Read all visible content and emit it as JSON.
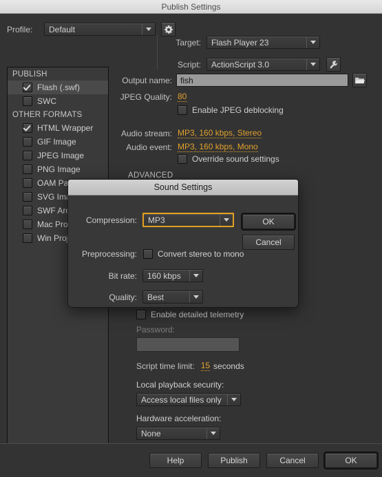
{
  "window": {
    "title": "Publish Settings"
  },
  "toolbar": {
    "profile_label": "Profile:",
    "profile_value": "Default",
    "profile_gear_icon": "gear-icon",
    "target_label": "Target:",
    "target_value": "Flash Player 23",
    "script_label": "Script:",
    "script_value": "ActionScript 3.0",
    "script_wrench_icon": "wrench-icon"
  },
  "sidebar": {
    "groups": [
      {
        "header": "PUBLISH",
        "items": [
          {
            "label": "Flash (.swf)",
            "checked": true,
            "selected": true
          },
          {
            "label": "SWC",
            "checked": false,
            "selected": false
          }
        ]
      },
      {
        "header": "OTHER FORMATS",
        "items": [
          {
            "label": "HTML Wrapper",
            "checked": true,
            "selected": false
          },
          {
            "label": "GIF Image",
            "checked": false,
            "selected": false
          },
          {
            "label": "JPEG Image",
            "checked": false,
            "selected": false
          },
          {
            "label": "PNG Image",
            "checked": false,
            "selected": false
          },
          {
            "label": "OAM Package",
            "checked": false,
            "selected": false
          },
          {
            "label": "SVG Image",
            "checked": false,
            "selected": false
          },
          {
            "label": "SWF Archive",
            "checked": false,
            "selected": false
          },
          {
            "label": "Mac Projector",
            "checked": false,
            "selected": false
          },
          {
            "label": "Win Projector",
            "checked": false,
            "selected": false
          }
        ]
      }
    ]
  },
  "main": {
    "output_name_label": "Output name:",
    "output_name_value": "fish",
    "folder_icon": "folder-icon",
    "jpeg_quality_label": "JPEG Quality:",
    "jpeg_quality_value": "80",
    "jpeg_deblocking_label": "Enable JPEG deblocking",
    "jpeg_deblocking_checked": false,
    "audio_stream_label": "Audio stream:",
    "audio_stream_value": "MP3, 160 kbps, Stereo",
    "audio_event_label": "Audio event:",
    "audio_event_value": "MP3, 160 kbps, Mono",
    "override_sound_label": "Override sound settings",
    "override_sound_checked": false,
    "advanced_header": "ADVANCED",
    "telemetry_label": "Enable detailed telemetry",
    "telemetry_checked": false,
    "password_label": "Password:",
    "password_value": "",
    "script_time_limit_label": "Script time limit:",
    "script_time_limit_value": "15",
    "script_time_limit_unit": "seconds",
    "local_playback_label": "Local playback security:",
    "local_playback_value": "Access local files only",
    "hardware_accel_label": "Hardware acceleration:",
    "hardware_accel_value": "None"
  },
  "footer": {
    "help_label": "Help",
    "publish_label": "Publish",
    "cancel_label": "Cancel",
    "ok_label": "OK"
  },
  "modal": {
    "title": "Sound Settings",
    "compression_label": "Compression:",
    "compression_value": "MP3",
    "ok_label": "OK",
    "cancel_label": "Cancel",
    "preprocessing_label": "Preprocessing:",
    "convert_mono_label": "Convert stereo to mono",
    "convert_mono_checked": false,
    "bitrate_label": "Bit rate:",
    "bitrate_value": "160 kbps",
    "quality_label": "Quality:",
    "quality_value": "Best"
  },
  "colors": {
    "accent_orange": "#e1a12c",
    "focus_border": "#e3a021",
    "window_bg": "#333333",
    "panel_bg": "#3a3a3a"
  }
}
